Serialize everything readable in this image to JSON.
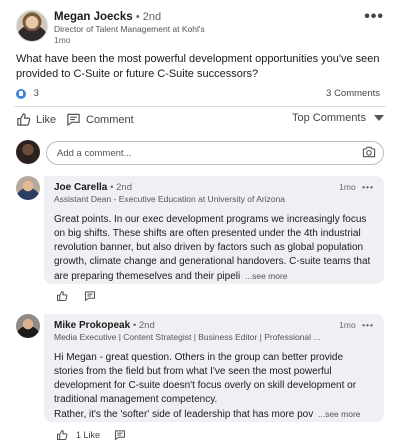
{
  "post": {
    "author_name": "Megan Joecks",
    "author_degree": "• 2nd",
    "author_headline": "Director of Talent Management at Kohl's",
    "time": "1mo",
    "more": "•••",
    "body": "What have been the most powerful development opportunities you've seen provided to C-Suite or future C-Suite successors?",
    "reactions_count": "3",
    "comments_count": "3 Comments"
  },
  "actions": {
    "like_label": "Like",
    "comment_label": "Comment",
    "sort_label": "Top Comments"
  },
  "compose": {
    "placeholder": "Add a comment..."
  },
  "comments": [
    {
      "name": "Joe Carella",
      "degree": "• 2nd",
      "headline": "Assistant Dean - Executive Education at University of Arizona",
      "time": "1mo",
      "more": "•••",
      "text": "Great points. In our exec development programs we increasingly focus on big shifts. These shifts are often presented under the 4th industrial revolution banner, but also driven by factors such as global population growth, climate change and generational handovers. C-suite teams that are preparing themeselves and their pipeli",
      "see_more": "...see more"
    },
    {
      "name": "Mike Prokopeak",
      "degree": "• 2nd",
      "headline": "Media Executive | Content Strategist | Business Editor | Professional ...",
      "time": "1mo",
      "more": "•••",
      "text": "Hi Megan - great question. Others in the group can better provide stories from the field but from what I've seen the most powerful development for C-suite doesn't focus overly on skill development or traditional management competency.",
      "text2": "Rather, it's the 'softer' side of leadership that has more pov",
      "see_more": "...see more",
      "likes": "1 Like"
    }
  ],
  "colors": {
    "accent_blue": "#3e86d6",
    "bubble_bg": "#eef0f3"
  }
}
